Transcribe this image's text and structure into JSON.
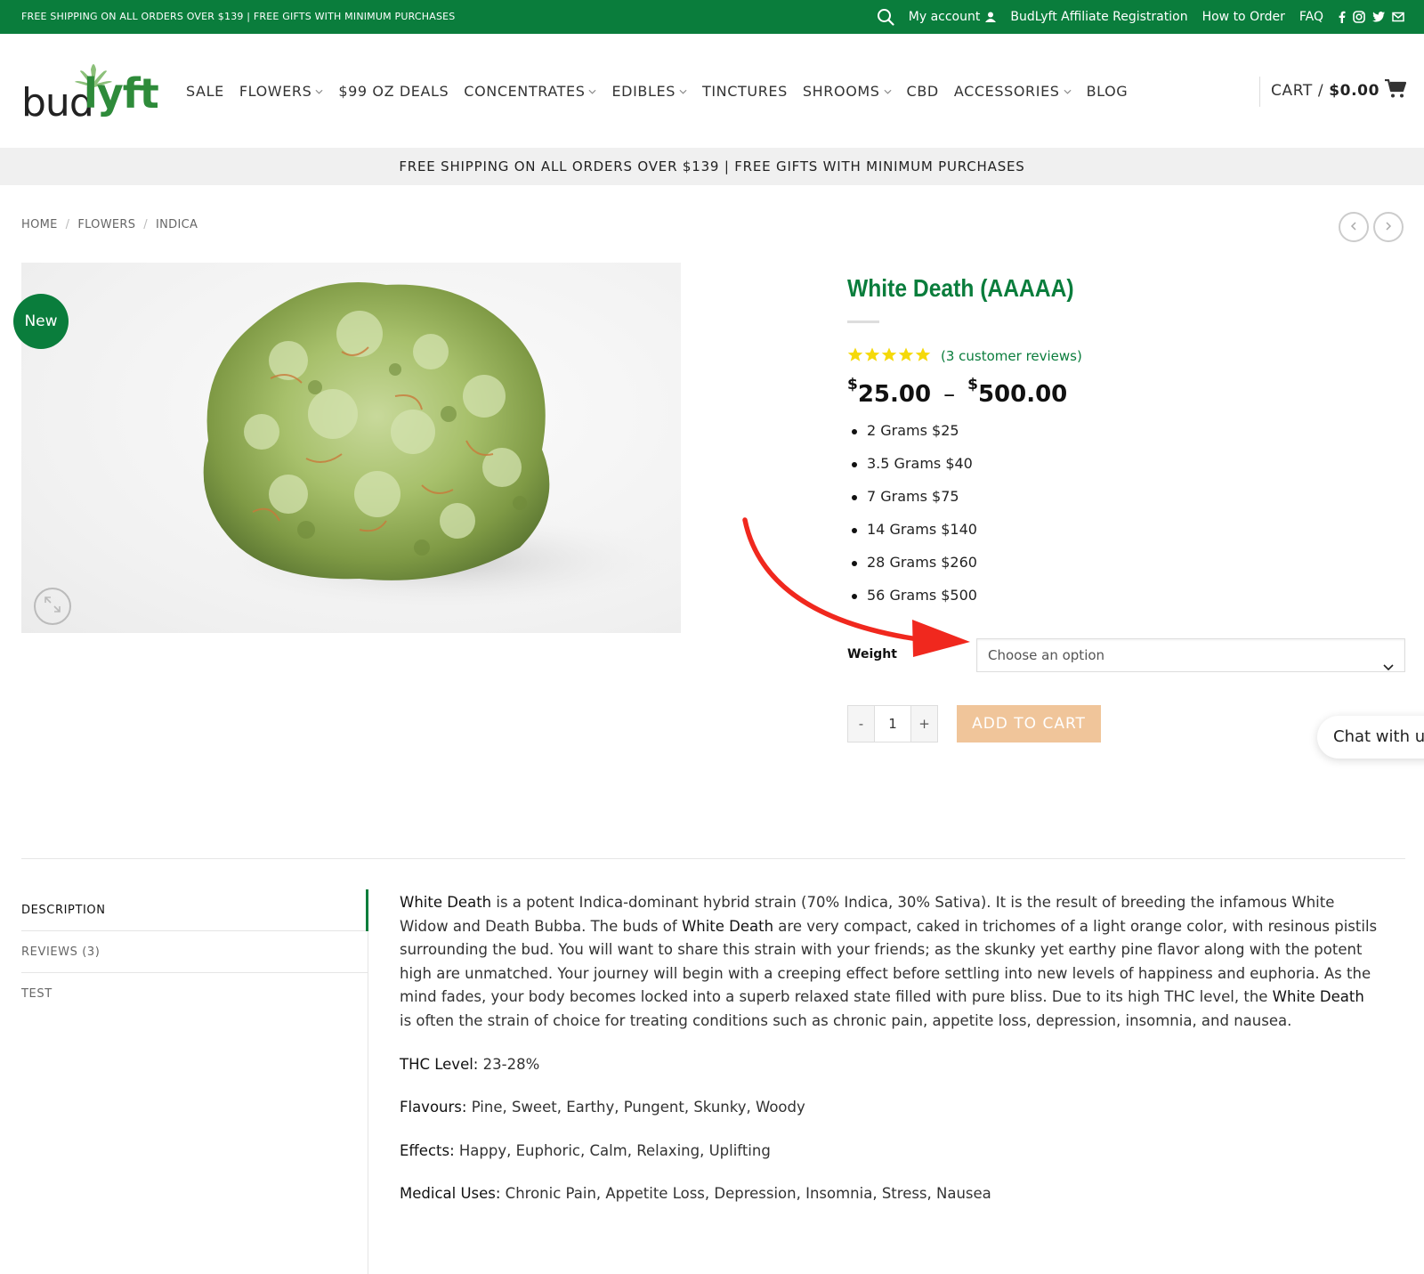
{
  "topbar": {
    "promo": "FREE SHIPPING ON ALL ORDERS OVER $139 | FREE GIFTS WITH MINIMUM PURCHASES",
    "my_account": "My account",
    "affiliate": "BudLyft Affiliate Registration",
    "how_to_order": "How to Order",
    "faq": "FAQ"
  },
  "logo": {
    "part1": "bud",
    "part2": "lyft"
  },
  "nav": {
    "items": [
      {
        "label": "SALE",
        "has_dropdown": false
      },
      {
        "label": "FLOWERS",
        "has_dropdown": true
      },
      {
        "label": "$99 OZ DEALS",
        "has_dropdown": false
      },
      {
        "label": "CONCENTRATES",
        "has_dropdown": true
      },
      {
        "label": "EDIBLES",
        "has_dropdown": true
      },
      {
        "label": "TINCTURES",
        "has_dropdown": false
      },
      {
        "label": "SHROOMS",
        "has_dropdown": true
      },
      {
        "label": "CBD",
        "has_dropdown": false
      },
      {
        "label": "ACCESSORIES",
        "has_dropdown": true
      },
      {
        "label": "BLOG",
        "has_dropdown": false
      }
    ]
  },
  "cart": {
    "label": "CART /",
    "amount": "$0.00"
  },
  "promobar": "FREE SHIPPING ON ALL ORDERS OVER $139 | FREE GIFTS WITH MINIMUM PURCHASES",
  "breadcrumb": {
    "home": "HOME",
    "flowers": "FLOWERS",
    "indica": "INDICA",
    "sep": "/"
  },
  "product": {
    "badge": "New",
    "title": "White Death (AAAAA)",
    "rating": 5,
    "reviews_link": "(3 customer reviews)",
    "price_min_currency": "$",
    "price_min": "25.00",
    "price_sep": "–",
    "price_max_currency": "$",
    "price_max": "500.00",
    "tiers": [
      "2 Grams $25",
      "3.5 Grams $40",
      "7 Grams $75",
      "14 Grams $140",
      "28 Grams $260",
      "56 Grams $500"
    ],
    "weight_label": "Weight",
    "weight_placeholder": "Choose an option",
    "qty_minus": "-",
    "qty_value": "1",
    "qty_plus": "+",
    "add_to_cart": "ADD TO CART"
  },
  "chat": "Chat with u",
  "tabs": [
    {
      "label": "DESCRIPTION",
      "active": true
    },
    {
      "label": "REVIEWS (3)",
      "active": false
    },
    {
      "label": "TEST",
      "active": false
    }
  ],
  "description": {
    "p1_s1": "White Death",
    "p1_t1": " is a potent Indica-dominant hybrid strain (70% Indica, 30% Sativa). It is the result of breeding the infamous White Widow and Death Bubba. The buds of ",
    "p1_s2": "White Death",
    "p1_t2": " are very compact, caked in trichomes of a light orange color, with resinous pistils surrounding the bud. You will want to share this strain with your friends; as the skunky yet earthy pine flavor along with the potent high are unmatched. Your journey will begin with a creeping effect before settling into new levels of happiness and euphoria. As the mind fades, your body becomes locked into a superb relaxed state filled with pure bliss. Due to its high THC level, the ",
    "p1_s3": "White Death",
    "p1_t3": " is often the strain of choice for treating conditions such as chronic pain, appetite loss, depression, insomnia, and nausea.",
    "thc_label": "THC Level:",
    "thc_value": " 23-28%",
    "flavours_label": "Flavours:",
    "flavours_value": " Pine, Sweet, Earthy, Pungent, Skunky, Woody",
    "effects_label": "Effects:",
    "effects_value": " Happy, Euphoric, Calm, Relaxing, Uplifting",
    "medical_label": "Medical Uses:",
    "medical_value": " Chronic Pain, Appetite Loss, Depression, Insomnia, Stress, Nausea"
  },
  "colors": {
    "brand_green": "#0a7d3c",
    "add_to_cart_bg": "#f0c59a",
    "star": "#f5d90a",
    "annotation_arrow": "#f0281e"
  },
  "icons": [
    "search-icon",
    "user-icon",
    "facebook-icon",
    "instagram-icon",
    "twitter-icon",
    "email-icon",
    "cart-icon",
    "chevron-down-icon",
    "prev-arrow-icon",
    "next-arrow-icon",
    "zoom-icon",
    "star-icon"
  ]
}
